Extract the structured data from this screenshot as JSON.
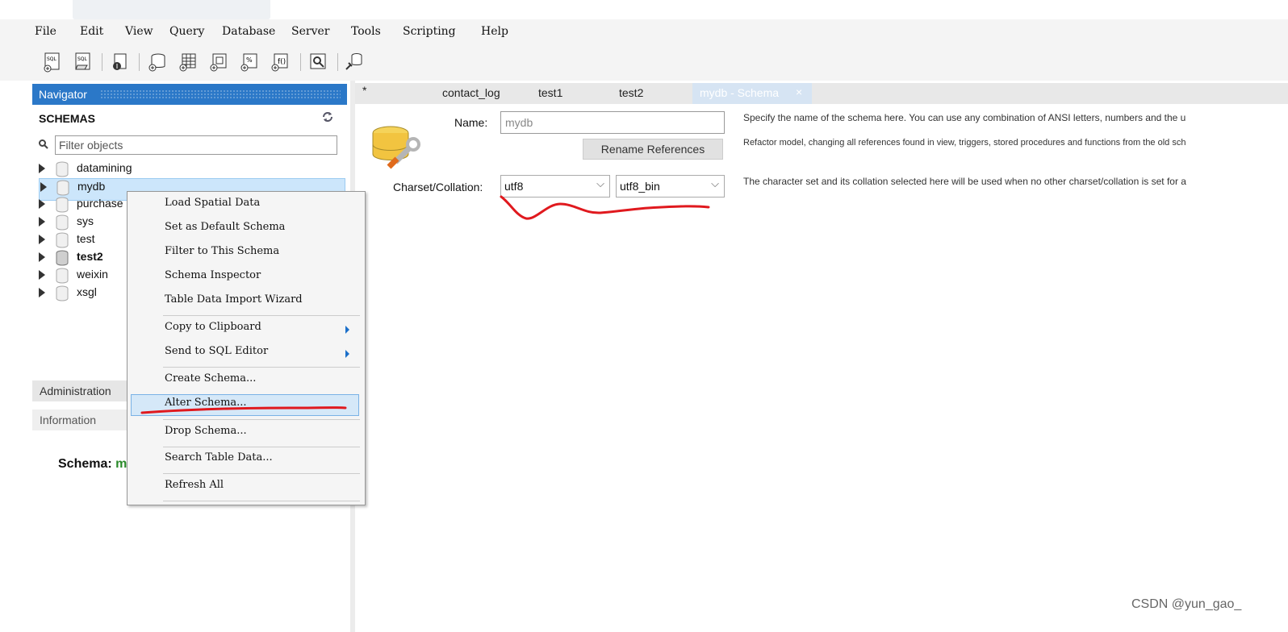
{
  "menu": [
    "File",
    "Edit",
    "View",
    "Query",
    "Database",
    "Server",
    "Tools",
    "Scripting",
    "Help"
  ],
  "toolbar_icons": [
    "new-sql-tab-icon",
    "open-sql-script-icon",
    "inspector-icon",
    "create-schema-icon",
    "create-table-icon",
    "create-view-icon",
    "create-procedure-icon",
    "create-function-icon",
    "search-data-icon",
    "reconnect-icon"
  ],
  "navigator": {
    "title": "Navigator",
    "schemas_label": "SCHEMAS",
    "filter_placeholder": "Filter objects",
    "schemas": [
      {
        "name": "datamining",
        "bold": false,
        "selected": false
      },
      {
        "name": "mydb",
        "bold": false,
        "selected": true
      },
      {
        "name": "purchase",
        "bold": false,
        "selected": false
      },
      {
        "name": "sys",
        "bold": false,
        "selected": false
      },
      {
        "name": "test",
        "bold": false,
        "selected": false
      },
      {
        "name": "test2",
        "bold": true,
        "selected": false
      },
      {
        "name": "weixin",
        "bold": false,
        "selected": false
      },
      {
        "name": "xsgl",
        "bold": false,
        "selected": false
      }
    ],
    "administration_tab": "Administration",
    "information_tab": "Information",
    "schema_info_label": "Schema:",
    "schema_info_value": "m"
  },
  "context_menu": {
    "items": [
      "Load Spatial Data",
      "Set as Default Schema",
      "Filter to This Schema",
      "Schema Inspector",
      "Table Data Import Wizard",
      "Copy to Clipboard",
      "Send to SQL Editor",
      "Create Schema...",
      "Alter Schema...",
      "Drop Schema...",
      "Search Table Data...",
      "Refresh All"
    ],
    "highlighted": "Alter Schema..."
  },
  "editor_tabs": {
    "first": "*",
    "tabs": [
      "contact_log",
      "test1",
      "test2"
    ],
    "active": "mydb - Schema",
    "close": "×"
  },
  "schema_editor": {
    "name_label": "Name:",
    "name_value": "mydb",
    "rename_button": "Rename References",
    "charset_label": "Charset/Collation:",
    "charset_value": "utf8",
    "collation_value": "utf8_bin",
    "help_name": "Specify the name of the schema here. You can use any combination of ANSI letters, numbers and the u",
    "help_refactor": "Refactor model, changing all references found in view, triggers, stored procedures and functions from the old sch",
    "help_charset": "The character set and its collation selected here will be used when no other charset/collation is set for a"
  },
  "watermark": "CSDN @yun_gao_",
  "colors": {
    "navigator_header": "#2b78c8",
    "selection": "#cce6fb",
    "annotation": "#e0191e"
  }
}
